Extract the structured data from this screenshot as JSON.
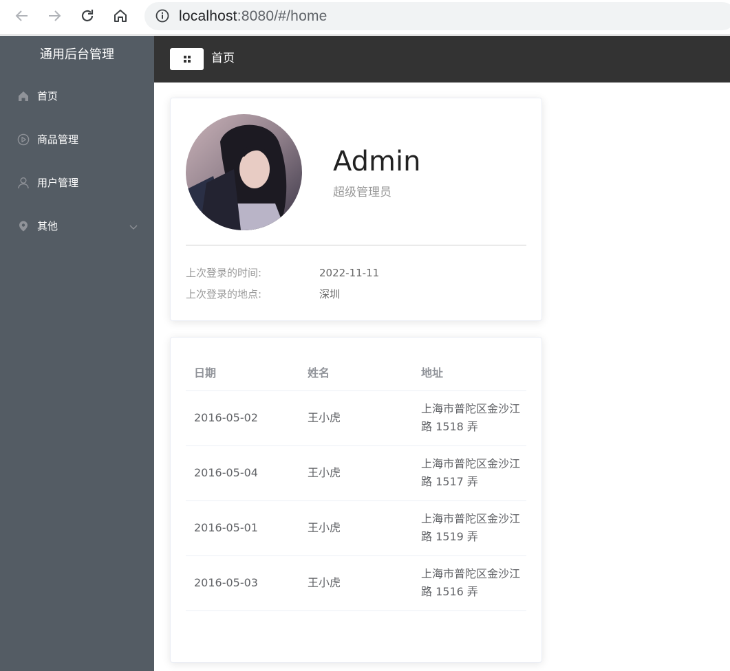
{
  "browser": {
    "url_host": "localhost",
    "url_rest": ":8080/#/home",
    "icons": [
      "back-arrow-icon",
      "forward-arrow-icon",
      "reload-icon",
      "home-icon",
      "info-icon"
    ]
  },
  "sidebar": {
    "brand": "通用后台管理",
    "items": [
      {
        "label": "首页",
        "icon": "home-icon"
      },
      {
        "label": "商品管理",
        "icon": "play-circle-icon"
      },
      {
        "label": "用户管理",
        "icon": "user-icon"
      },
      {
        "label": "其他",
        "icon": "location-pin-icon"
      }
    ]
  },
  "header": {
    "breadcrumb": "首页"
  },
  "user": {
    "name": "Admin",
    "role": "超级管理员",
    "last_login_time_label": "上次登录的时间:",
    "last_login_time": "2022-11-11",
    "last_login_place_label": "上次登录的地点:",
    "last_login_place": "深圳"
  },
  "table": {
    "headers": [
      "日期",
      "姓名",
      "地址"
    ],
    "rows": [
      {
        "date": "2016-05-02",
        "name": "王小虎",
        "address": "上海市普陀区金沙江路 1518 弄"
      },
      {
        "date": "2016-05-04",
        "name": "王小虎",
        "address": "上海市普陀区金沙江路 1517 弄"
      },
      {
        "date": "2016-05-01",
        "name": "王小虎",
        "address": "上海市普陀区金沙江路 1519 弄"
      },
      {
        "date": "2016-05-03",
        "name": "王小虎",
        "address": "上海市普陀区金沙江路 1516 弄"
      }
    ]
  },
  "colors": {
    "sidebar_bg": "#545c64",
    "header_bg": "#333333",
    "muted_text": "#999999",
    "table_text": "#606266"
  }
}
